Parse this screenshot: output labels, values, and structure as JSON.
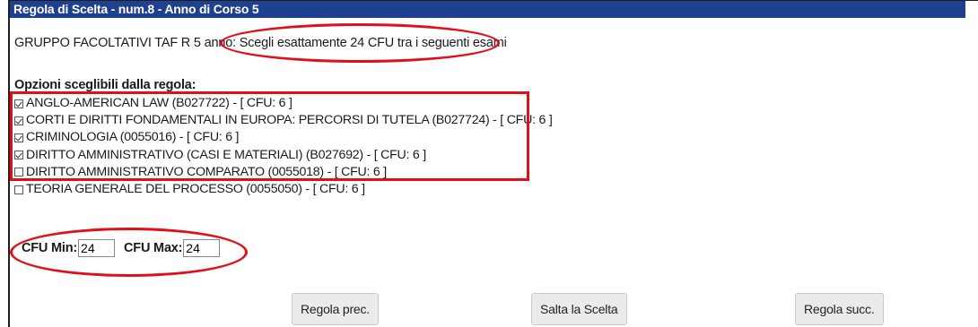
{
  "header": {
    "title": "Regola di Scelta - num.8 - Anno di Corso 5"
  },
  "rule": {
    "group_label": "GRUPPO FACOLTATIVI TAF R 5 anno",
    "separator": ":",
    "instruction": "Scegli esattamente 24 CFU tra i seguenti esami"
  },
  "options": {
    "title": "Opzioni sceglibili dalla regola:",
    "items": [
      {
        "label": "ANGLO-AMERICAN LAW (B027722) - [ CFU: 6 ]",
        "checked": true
      },
      {
        "label": "CORTI E DIRITTI FONDAMENTALI IN EUROPA: PERCORSI DI TUTELA (B027724) - [ CFU: 6 ]",
        "checked": true
      },
      {
        "label": "CRIMINOLOGIA (0055016) - [ CFU: 6 ]",
        "checked": true
      },
      {
        "label": "DIRITTO AMMINISTRATIVO (CASI E MATERIALI) (B027692) - [ CFU: 6 ]",
        "checked": true
      },
      {
        "label": "DIRITTO AMMINISTRATIVO COMPARATO (0055018) - [ CFU: 6 ]",
        "checked": false
      },
      {
        "label": "TEORIA GENERALE DEL PROCESSO (0055050) - [ CFU: 6 ]",
        "checked": false
      }
    ]
  },
  "cfu": {
    "min_label": "CFU Min:",
    "min_value": "24",
    "max_label": "CFU Max:",
    "max_value": "24"
  },
  "buttons": {
    "prev": "Regola prec.",
    "skip": "Salta la Scelta",
    "next": "Regola succ."
  },
  "colors": {
    "header_bg": "#1f3f8f",
    "annotation": "#e0101a"
  }
}
